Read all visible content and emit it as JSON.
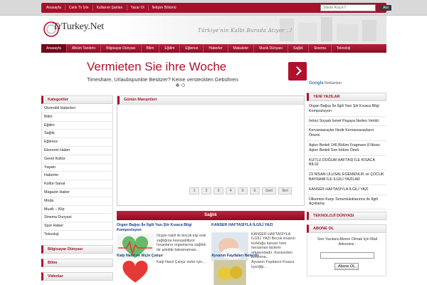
{
  "colors": {
    "brand": "#b0102c",
    "nav": "#a3112a",
    "link": "#1a3d8f"
  },
  "topbar": {
    "links": [
      "Anasayfa",
      "Canlı Tv İzle",
      "Kullanım Şartları",
      "Yazar Ol",
      "İletişim Bölümü"
    ],
    "search_placeholder": "Sitede Arayın?",
    "search_button": "Ara"
  },
  "header": {
    "logo_text": "TrTurkey.Net",
    "slogan": "Türkiye'nin Kalbi Burada Atıyor ..!"
  },
  "nav": {
    "items": [
      "Anasayfa",
      "Albüm Tanıtımı",
      "Bilgisayar Dünyası",
      "Bilim",
      "Eğitim",
      "Eğlence",
      "Haberler",
      "Makaleler",
      "Muzik Dünyası",
      "Sağlık",
      "Sinema",
      "Teknoloji"
    ]
  },
  "ad": {
    "title": "Vermieten Sie ihre Woche",
    "subtitle": "Timeshare, Urlaubspunkte Besitzer? Keine versteckten Gebühren.",
    "choices_brand": "Google",
    "choices_label": "Reklamları"
  },
  "left": {
    "categories_title": "Kategoriler",
    "categories": [
      "Otomobil Haberleri",
      "Bilim",
      "Eğitim",
      "Sağlık",
      "Eğlence",
      "Ekonomi Haber",
      "Genel Kültür",
      "Yaşam",
      "Haberler",
      "Kültür-Sanat",
      "Magazin Haber",
      "Moda",
      "Muzik – Klip",
      "Sinema Dunyasi",
      "Spor Haber",
      "Teknoloji"
    ],
    "box2_title": "Bilgisayar Dünyası",
    "box3_title": "Bilim",
    "box4_title": "Videolar"
  },
  "middle": {
    "manset_title": "Günün Manşetleri",
    "pager": [
      "1",
      "2",
      "3",
      "4",
      "5",
      "6",
      "Geri",
      "İleri"
    ],
    "section_title": "Sağlık",
    "news": [
      {
        "title": "Organ Bağışı İle İlgili Yazı Şiir Kısaca Bilgi Kompozisyon",
        "text": "Organ nakli ile birçok kişi eski sağlığına kavuşabiliyor. İnsanların organlarına sağlıklı bir şekilde bakamaması..."
      },
      {
        "title": "KANSER HAFTASIYLA İLGİLİ YAZI",
        "text": "KANSER HAFTASIYLA İLGİLİ YAZI Birçok insanın korktuğu kanser hem herzaman bizlerin arkasındadır .Kanserden korunma..."
      },
      {
        "title": "Kalp Nasıl ve Niçin Çalışır",
        "text": "Kalp Nasıl Çalışır sizler için..."
      },
      {
        "title": "Ayvanın Faydaları Nelerdir",
        "text": "Ayvanın Faydanın Kısaca İçerdiği..."
      }
    ]
  },
  "right": {
    "recent_title": "YENİ YAZILAR",
    "recent": [
      "Organ Bağışı İle İlgili Yazı Şiir Kısaca Bilgi Kompozisyon",
      "İnönü Soyadı İsmet Paşaya Neden Verildi",
      "Kervansaraylar Nedir Kervansarayların Önemi",
      "Aşkın Bedeli 146.Bölüm Fragmanı 8 Nisan Aşkın Bedeli Son bölüm Özeti",
      "KUTLU DOĞUM HAFTASI İLE KISACA BİLGİ",
      "23 NİSAN ULUSAL EGEMENLİK ve ÇOCUK BAYRAMI İLE İLGİLİ YAZILAR",
      "KANSER HAFTASIYLA İLGİLİ YAZI",
      "Ülkemize Karşı Sorumluluklarımız ile İlgili Açıklama"
    ],
    "tech_title": "TEKNOLOJİ DÜNYASI",
    "subscribe_title": "ABONE OL",
    "subscribe_text": "Son Yazılara Abone Olmak İçin Mail Adresiniz :",
    "subscribe_button": "Abone OL"
  }
}
